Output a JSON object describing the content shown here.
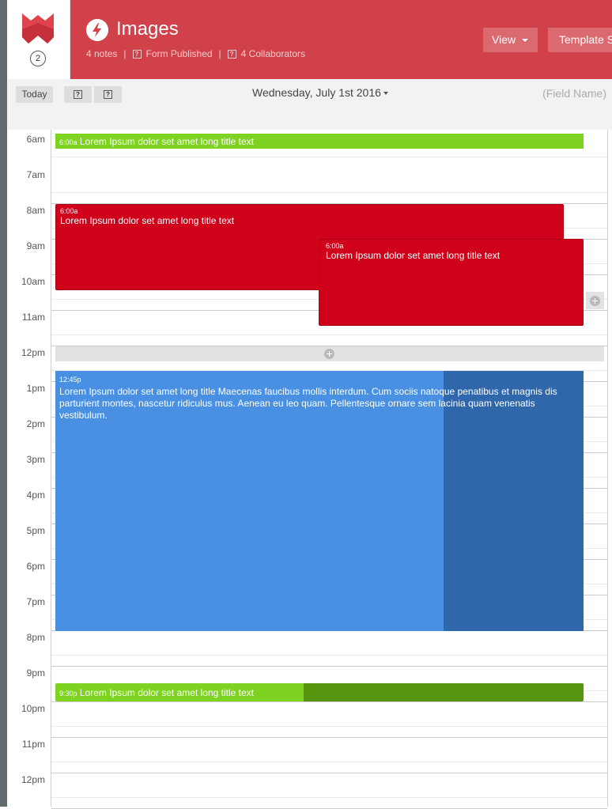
{
  "header": {
    "title": "Images",
    "notes": "4 notes",
    "form_status": "Form Published",
    "collaborators": "4 Collaborators",
    "badge_count": "2",
    "view_label": "View",
    "template_label": "Template S",
    "brand_color": "#d0414a"
  },
  "toolbar": {
    "today": "Today",
    "date": "Wednesday, July 1st 2016",
    "field_name": "(Field Name)"
  },
  "calendar": {
    "hours": [
      "6am",
      "7am",
      "8am",
      "9am",
      "10am",
      "11am",
      "12pm",
      "1pm",
      "2pm",
      "3pm",
      "4pm",
      "5pm",
      "6pm",
      "7pm",
      "8pm",
      "9pm",
      "10pm",
      "11pm",
      "12pm"
    ],
    "events": [
      {
        "time": "6:00a",
        "title": "Lorem Ipsum dolor set amet long title text"
      },
      {
        "time": "6:00a",
        "title": "Lorem Ipsum dolor set amet long title text"
      },
      {
        "time": "6:00a",
        "title": "Lorem Ipsum dolor set amet long title text"
      },
      {
        "time": "12:45p",
        "title": "Lorem Ipsum dolor set amet long title Maecenas faucibus mollis interdum. Cum sociis natoque penatibus et magnis dis parturient montes, nascetur ridiculus mus. Aenean eu leo quam. Pellentesque ornare sem lacinia quam venenatis vestibulum."
      },
      {
        "time": "9:30p",
        "title": "Lorem Ipsum dolor set amet long title text"
      }
    ]
  },
  "colors": {
    "green": "#7ed321",
    "red": "#d0021b",
    "blue": "#4a90e2"
  }
}
